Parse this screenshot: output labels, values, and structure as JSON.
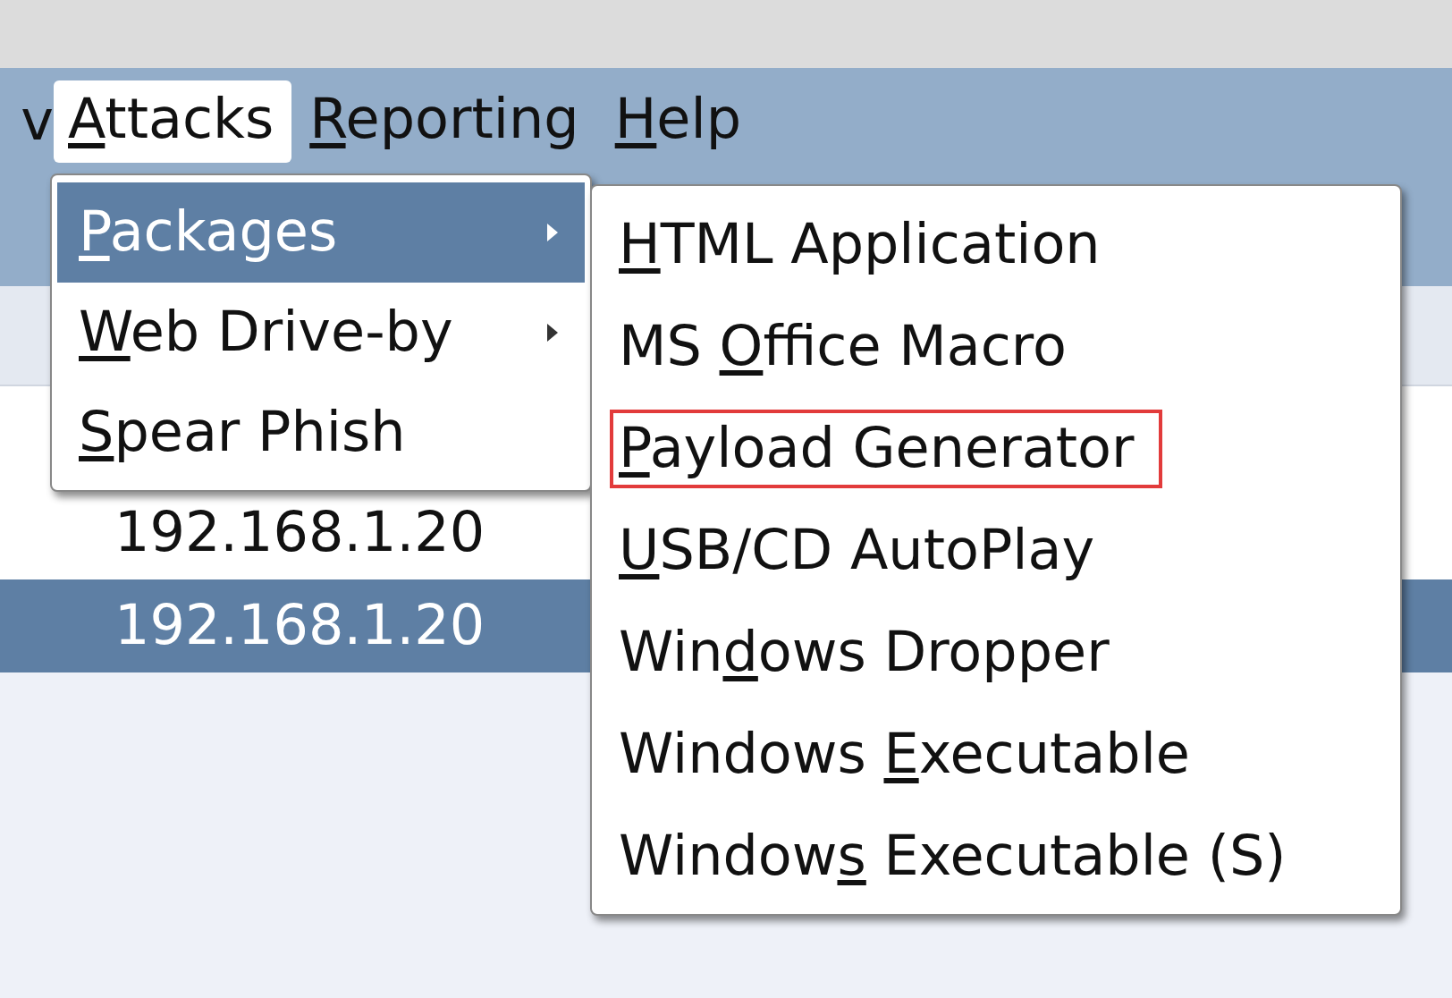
{
  "menubar": {
    "cut_item": "v",
    "items": [
      {
        "key": "A",
        "post": "ttacks",
        "selected": true
      },
      {
        "key": "R",
        "post": "eporting",
        "selected": false
      },
      {
        "key": "H",
        "post": "elp",
        "selected": false
      }
    ]
  },
  "table": {
    "rows": [
      {
        "ip": "192.168.1.20",
        "selected": false
      },
      {
        "ip": "192.168.1.20",
        "selected": true
      }
    ]
  },
  "attacks_menu": [
    {
      "key": "P",
      "post": "ackages",
      "submenu": true,
      "selected": true
    },
    {
      "key": "W",
      "post": "eb Drive-by",
      "submenu": true,
      "selected": false
    },
    {
      "key": "S",
      "post": "pear Phish",
      "submenu": false,
      "selected": false
    }
  ],
  "packages_menu": [
    {
      "key": "H",
      "post": "TML Application",
      "highlighted": false
    },
    {
      "pre": "MS ",
      "key": "O",
      "post": "ffice Macro",
      "highlighted": false
    },
    {
      "key": "P",
      "post": "ayload Generator",
      "highlighted": true
    },
    {
      "key": "U",
      "post": "SB/CD AutoPlay",
      "highlighted": false
    },
    {
      "pre": "Win",
      "key": "d",
      "post": "ows Dropper",
      "highlighted": false
    },
    {
      "pre": "Windows ",
      "key": "E",
      "post": "xecutable",
      "highlighted": false
    },
    {
      "pre": "Window",
      "key": "s",
      "post": " Executable (S)",
      "highlighted": false
    }
  ]
}
